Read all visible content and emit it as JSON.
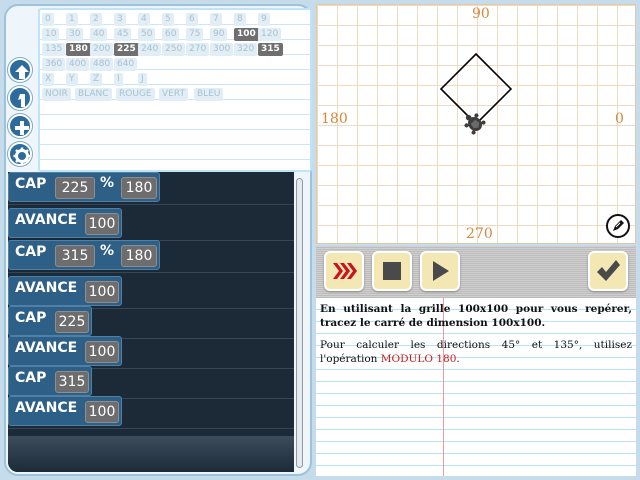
{
  "palette": {
    "row1": [
      "0",
      "1",
      "2",
      "3",
      "4",
      "5",
      "6",
      "7",
      "8",
      "9"
    ],
    "row2": [
      "10",
      "30",
      "40",
      "45",
      "50",
      "60",
      "75",
      "90",
      "100",
      "120"
    ],
    "row3": [
      "135",
      "180",
      "200",
      "225",
      "240",
      "250",
      "270",
      "300",
      "320",
      "315"
    ],
    "row4": [
      "360",
      "400",
      "480",
      "640"
    ],
    "row5": [
      "X",
      "Y",
      "Z",
      "I",
      "J"
    ],
    "row6": [
      "NOIR",
      "BLANC",
      "ROUGE",
      "VERT",
      "BLEU"
    ],
    "highlighted": [
      "100",
      "180",
      "225",
      "315"
    ]
  },
  "side_buttons": [
    "up-arrow-icon",
    "step-icon",
    "plus-icon",
    "gear-icon"
  ],
  "program": [
    {
      "keyword": "CAP",
      "a": "225",
      "op": "%",
      "b": "180"
    },
    {
      "keyword": "AVANCE",
      "a": "100"
    },
    {
      "keyword": "CAP",
      "a": "315",
      "op": "%",
      "b": "180"
    },
    {
      "keyword": "AVANCE",
      "a": "100"
    },
    {
      "keyword": "CAP",
      "a": "225"
    },
    {
      "keyword": "AVANCE",
      "a": "100"
    },
    {
      "keyword": "CAP",
      "a": "315"
    },
    {
      "keyword": "AVANCE",
      "a": "100"
    }
  ],
  "canvas": {
    "label_top": "90",
    "label_left": "180",
    "label_right": "0",
    "label_bottom": "270",
    "square_size": 100,
    "grid_step": 100
  },
  "toolbar": {
    "buttons": [
      "fast-forward-icon",
      "stop-icon",
      "play-icon",
      "check-icon"
    ]
  },
  "instructions": {
    "p1": "En utilisant la grille 100x100 pour vous repérer, tracez le carré de dimension 100x100.",
    "p2_before": "Pour calculer les directions 45° et 135°, utilisez l'opération ",
    "p2_highlight": "MODULO 180",
    "p2_after": "."
  },
  "colors": {
    "accent_red": "#d01818",
    "label_orange": "#d7873a",
    "block_blue": "#2e5f86",
    "button_cream": "#f3e7b4"
  }
}
